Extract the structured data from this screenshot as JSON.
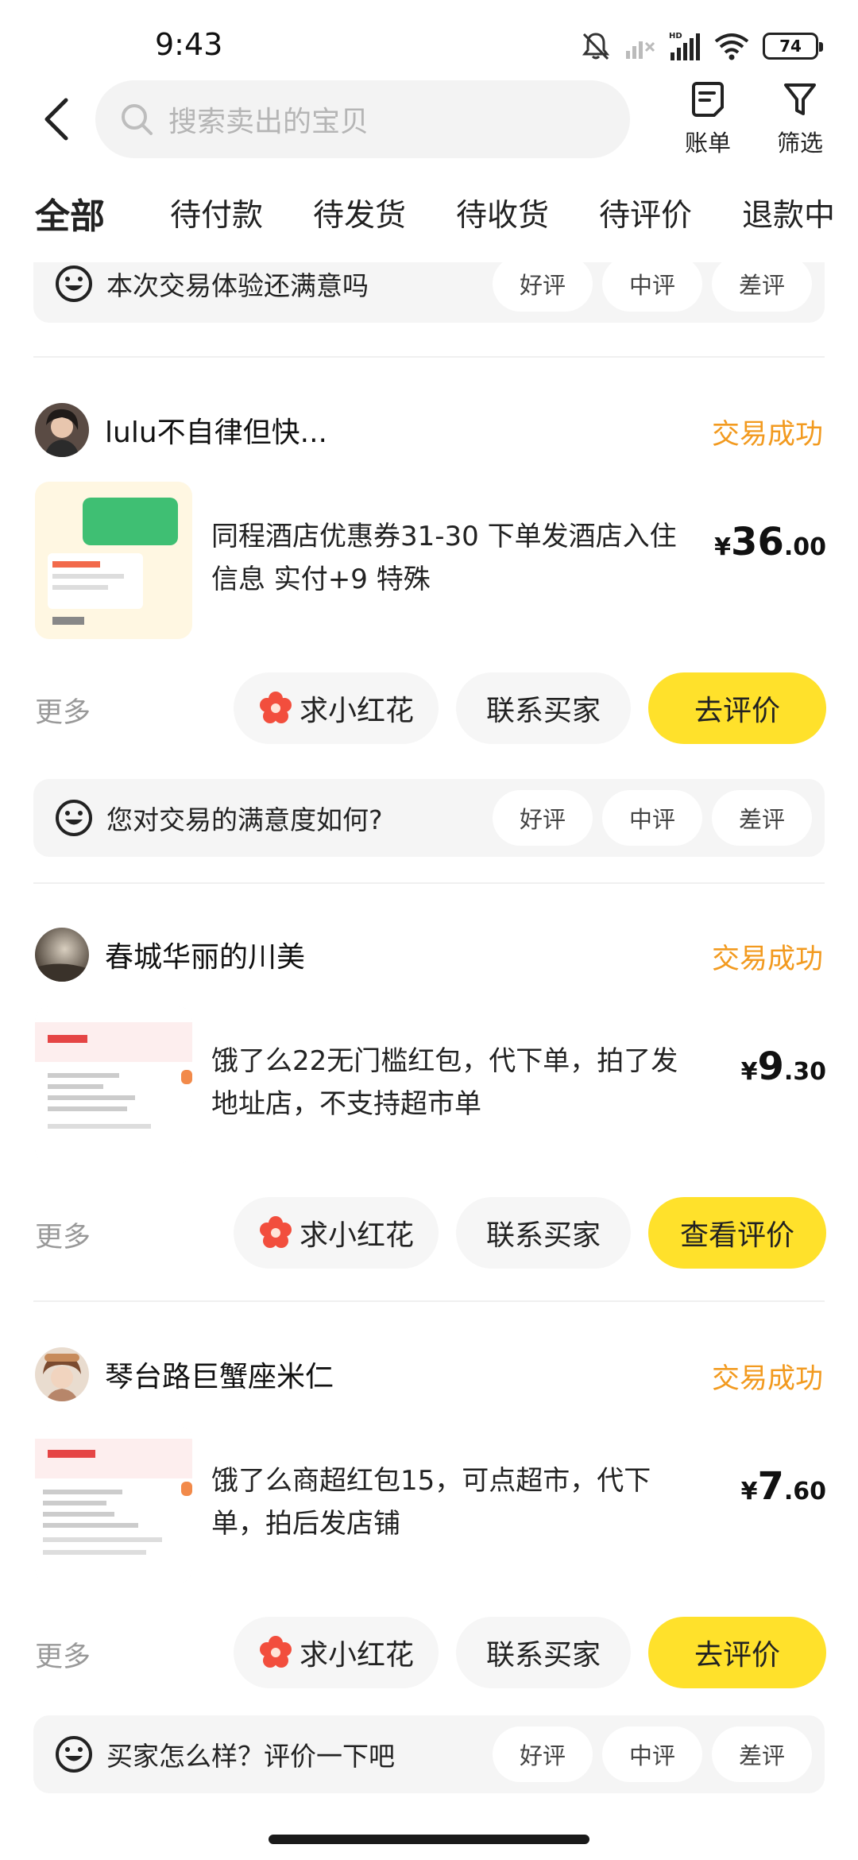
{
  "status_bar": {
    "time": "9:43",
    "battery": "74",
    "network": "HD"
  },
  "header": {
    "search_placeholder": "搜索卖出的宝贝",
    "bill_label": "账单",
    "filter_label": "筛选"
  },
  "tabs": [
    {
      "label": "全部",
      "active": true
    },
    {
      "label": "待付款"
    },
    {
      "label": "待发货"
    },
    {
      "label": "待收货"
    },
    {
      "label": "待评价"
    },
    {
      "label": "退款中"
    }
  ],
  "rating_options": [
    "好评",
    "中评",
    "差评"
  ],
  "top_rating_prompt": "本次交易体验还满意吗",
  "orders": [
    {
      "seller": "lulu不自律但快...",
      "status": "交易成功",
      "title": "同程酒店优惠券31-30 下单发酒店入住信息 实付+9 特殊",
      "price_currency": "¥",
      "price_int": "36",
      "price_dec": ".00",
      "more": "更多",
      "flower_btn": "求小红花",
      "contact_btn": "联系买家",
      "primary_btn": "去评价",
      "rating_prompt": "您对交易的满意度如何?"
    },
    {
      "seller": "春城华丽的川美",
      "status": "交易成功",
      "title": "饿了么22无门槛红包，代下单，拍了发地址店，不支持超市单",
      "price_currency": "¥",
      "price_int": "9",
      "price_dec": ".30",
      "more": "更多",
      "flower_btn": "求小红花",
      "contact_btn": "联系买家",
      "primary_btn": "查看评价"
    },
    {
      "seller": "琴台路巨蟹座米仁",
      "status": "交易成功",
      "title": "饿了么商超红包15，可点超市，代下单，拍后发店铺",
      "price_currency": "¥",
      "price_int": "7",
      "price_dec": ".60",
      "more": "更多",
      "flower_btn": "求小红花",
      "contact_btn": "联系买家",
      "primary_btn": "去评价",
      "rating_prompt": "买家怎么样？评价一下吧"
    }
  ],
  "colors": {
    "accent_yellow": "#ffe12b",
    "status_orange": "#f29a1f",
    "flower_red": "#f24e3d"
  }
}
